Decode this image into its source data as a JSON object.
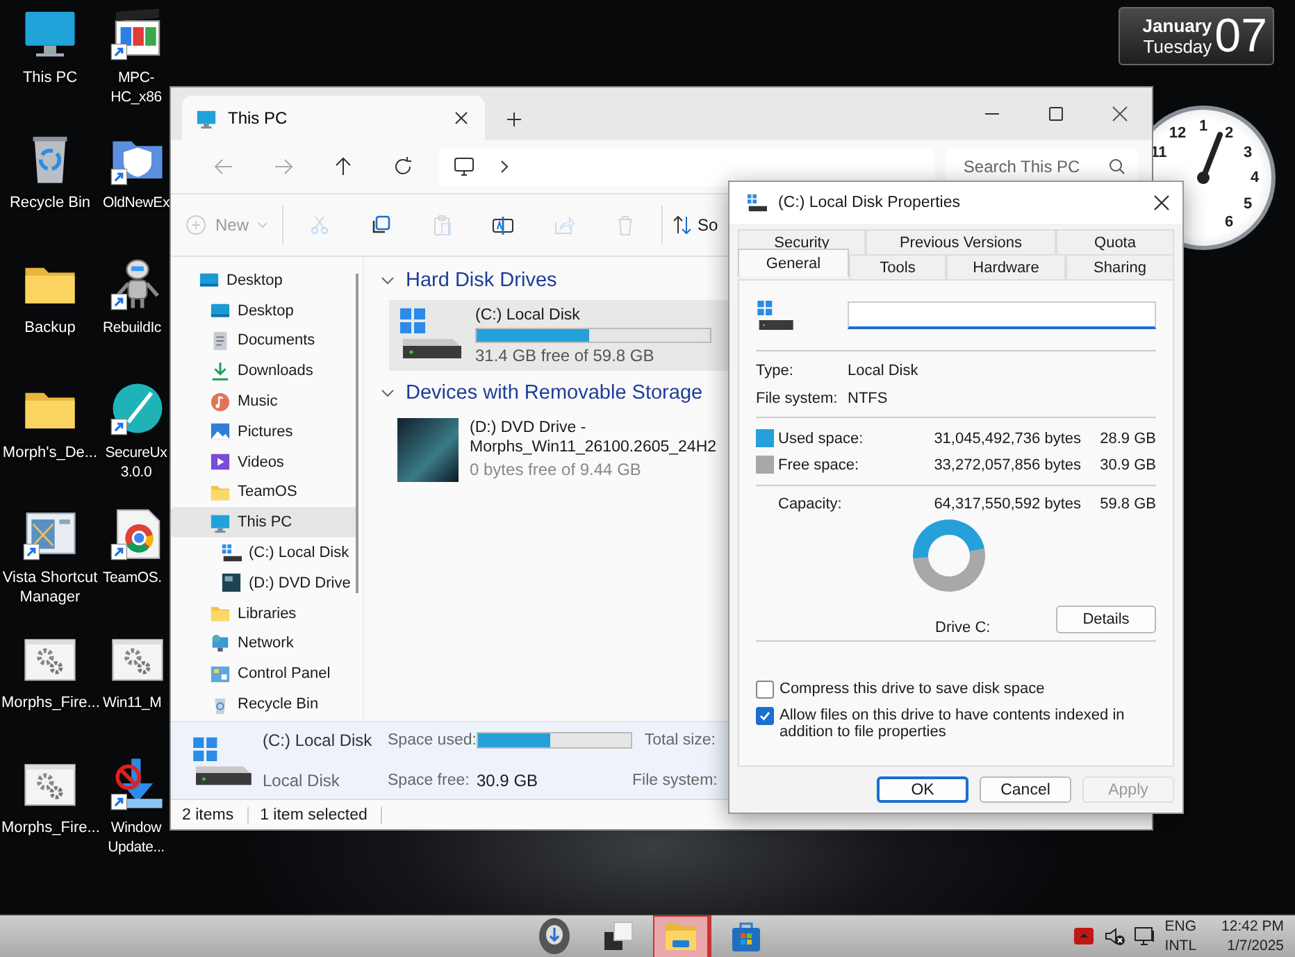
{
  "desktop_icons": [
    {
      "label": "This PC",
      "kind": "monitor",
      "shortcut": false
    },
    {
      "label": "Recycle Bin",
      "kind": "recycle",
      "shortcut": false
    },
    {
      "label": "Backup",
      "kind": "folder",
      "shortcut": false
    },
    {
      "label": "Morph's_De...",
      "kind": "folder",
      "shortcut": false
    },
    {
      "label": "Vista Shortcut Manager",
      "kind": "window",
      "shortcut": true
    },
    {
      "label": "Morphs_Fire...",
      "kind": "gear",
      "shortcut": false
    },
    {
      "label": "Morphs_Fire...",
      "kind": "gear",
      "shortcut": false
    },
    {
      "label": "MPC-HC_x86",
      "kind": "media",
      "shortcut": true
    },
    {
      "label": "OldNewEx",
      "kind": "shield",
      "shortcut": true
    },
    {
      "label": "RebuildIc",
      "kind": "robot",
      "shortcut": true
    },
    {
      "label": "SecureUx 3.0.0",
      "kind": "pen",
      "shortcut": true
    },
    {
      "label": "TeamOS.",
      "kind": "browser",
      "shortcut": true
    },
    {
      "label": "Win11_M",
      "kind": "gear",
      "shortcut": false
    },
    {
      "label": "Window Update...",
      "kind": "blocked",
      "shortcut": true
    }
  ],
  "date_gadget": {
    "month": "January",
    "weekday": "Tuesday",
    "day": "07"
  },
  "clock_gadget": {
    "numerals": [
      "11",
      "12",
      "1",
      "2",
      "3",
      "4",
      "5",
      "6"
    ]
  },
  "explorer": {
    "tabs": [
      {
        "title": "This PC",
        "selected": true
      }
    ],
    "search": {
      "placeholder": "Search This PC"
    },
    "toolbar": [
      {
        "kind": "new",
        "label": "New",
        "disabled": true
      },
      {
        "kind": "cut",
        "disabled": true
      },
      {
        "kind": "copy",
        "disabled": false
      },
      {
        "kind": "paste",
        "disabled": true
      },
      {
        "kind": "rename",
        "disabled": false
      },
      {
        "kind": "share",
        "disabled": true
      },
      {
        "kind": "delete",
        "disabled": true
      },
      {
        "kind": "sort",
        "label": "So",
        "disabled": false
      }
    ],
    "sidebar": [
      {
        "label": "Desktop",
        "kind": "desktop",
        "selected": false,
        "children": [
          {
            "label": "Desktop",
            "kind": "desktop",
            "selected": false
          },
          {
            "label": "Documents",
            "kind": "documents",
            "selected": false
          },
          {
            "label": "Downloads",
            "kind": "downloads",
            "selected": false
          },
          {
            "label": "Music",
            "kind": "music",
            "selected": false
          },
          {
            "label": "Pictures",
            "kind": "pictures",
            "selected": false
          },
          {
            "label": "Videos",
            "kind": "videos",
            "selected": false
          },
          {
            "label": "TeamOS",
            "kind": "folder",
            "selected": false
          },
          {
            "label": "This PC",
            "kind": "pc",
            "selected": true,
            "children": [
              {
                "label": "(C:) Local Disk",
                "kind": "disk",
                "selected": false
              },
              {
                "label": "(D:) DVD Drive",
                "kind": "dvd",
                "selected": false
              }
            ]
          },
          {
            "label": "Libraries",
            "kind": "folder",
            "selected": false
          },
          {
            "label": "Network",
            "kind": "network",
            "selected": false
          },
          {
            "label": "Control Panel",
            "kind": "control",
            "selected": false
          },
          {
            "label": "Recycle Bin",
            "kind": "recycle",
            "selected": false
          }
        ]
      }
    ],
    "groups": [
      {
        "title": "Hard Disk Drives",
        "expanded": true,
        "items": [
          {
            "kind": "disk",
            "name": "(C:) Local Disk",
            "level": 0.48,
            "info": "31.4 GB free of 59.8 GB",
            "selected": true
          }
        ]
      },
      {
        "title": "Devices with Removable Storage",
        "expanded": true,
        "items": [
          {
            "kind": "dvd",
            "name": "(D:) DVD Drive - Morphs_Win11_26100.2605_24H2",
            "info": "0 bytes free of 9.44 GB",
            "selected": false
          }
        ]
      }
    ],
    "details": {
      "name": "(C:) Local Disk",
      "type": "Local Disk",
      "used_label": "Space used:",
      "level": 0.47,
      "free_label": "Space free:",
      "free_value": "30.9 GB",
      "total_label": "Total size:",
      "fs_label": "File system:"
    },
    "status_bar": {
      "item_count": "2 items",
      "selection": "1 item selected"
    }
  },
  "properties_dialog": {
    "title": "(C:) Local Disk Properties",
    "tab_rows": [
      {
        "tabs": [
          {
            "label": "Security",
            "selected": false
          },
          {
            "label": "Previous Versions",
            "selected": false
          },
          {
            "label": "Quota",
            "selected": false
          }
        ]
      },
      {
        "tabs": [
          {
            "label": "General",
            "selected": true
          },
          {
            "label": "Tools",
            "selected": false
          },
          {
            "label": "Hardware",
            "selected": false
          },
          {
            "label": "Sharing",
            "selected": false
          }
        ]
      }
    ],
    "properties": [
      {
        "label": "Type:",
        "value": "Local Disk"
      },
      {
        "label": "File system:",
        "value": "NTFS"
      }
    ],
    "space": [
      {
        "label": "Used space:",
        "color": "#26a0da",
        "bytes": "31,045,492,736 bytes",
        "size": "28.9 GB"
      },
      {
        "label": "Free space:",
        "color": "#a8a8a8",
        "bytes": "33,272,057,856 bytes",
        "size": "30.9 GB"
      }
    ],
    "capacity": {
      "label": "Capacity:",
      "bytes": "64,317,550,592 bytes",
      "size": "59.8 GB"
    },
    "chart_data": {
      "type": "donut",
      "values": [
        48.3,
        51.7
      ]
    },
    "drive_label": "Drive C:",
    "details_button": "Details",
    "options": [
      {
        "label": "Compress this drive to save disk space",
        "checked": false
      },
      {
        "label": "Allow files on this drive to have contents indexed in addition to file properties",
        "checked": true
      }
    ],
    "buttons": [
      {
        "label": "OK",
        "kind": "default",
        "disabled": false
      },
      {
        "label": "Cancel",
        "kind": "normal",
        "disabled": false
      },
      {
        "label": "Apply",
        "kind": "normal",
        "disabled": true
      }
    ]
  },
  "taskbar": {
    "apps": [
      {
        "kind": "orb",
        "selected": false
      },
      {
        "kind": "task-view",
        "selected": false
      },
      {
        "kind": "file-explorer",
        "selected": true
      },
      {
        "kind": "store",
        "selected": false
      }
    ],
    "tray": [
      {
        "kind": "overflow"
      },
      {
        "kind": "volume-muted"
      },
      {
        "kind": "network"
      }
    ],
    "language": {
      "line1": "ENG",
      "line2": "INTL"
    },
    "clock": {
      "time": "12:42 PM",
      "date": "1/7/2025"
    }
  }
}
